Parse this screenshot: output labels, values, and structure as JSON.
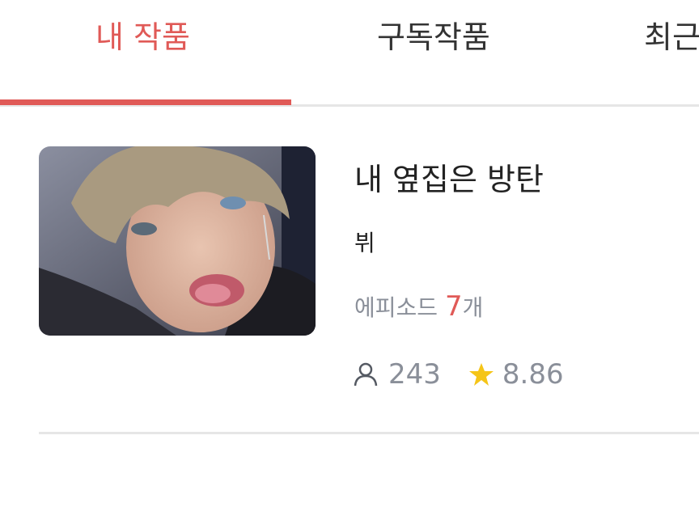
{
  "tabs": [
    {
      "label": "내 작품",
      "active": true
    },
    {
      "label": "구독작품",
      "active": false
    },
    {
      "label": "최근",
      "active": false
    }
  ],
  "item": {
    "title": "내 옆집은 방탄",
    "author": "뷔",
    "episodes_prefix": "에피소드 ",
    "episodes_count": "7",
    "episodes_suffix": "개",
    "views": "243",
    "rating": "8.86",
    "thumbnail_icon": "portrait-thumbnail"
  },
  "colors": {
    "accent": "#e05a57",
    "muted": "#8a8f99",
    "star": "#f5c518",
    "divider": "#e6e6e6"
  }
}
